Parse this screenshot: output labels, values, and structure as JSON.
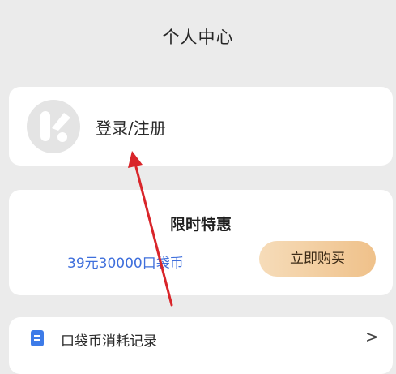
{
  "header": {
    "title": "个人中心"
  },
  "login": {
    "label": "登录/注册",
    "avatar_icon": "app-logo-k-icon"
  },
  "promo": {
    "title": "限时特惠",
    "description": "39元30000口袋币",
    "button_label": "立即购买"
  },
  "menu": {
    "items": [
      {
        "label": "口袋币消耗记录",
        "icon": "document-icon",
        "chevron": ">"
      }
    ]
  },
  "colors": {
    "background": "#ebebeb",
    "card": "#ffffff",
    "promo_text": "#3f6fdc",
    "button_gradient_start": "#f6dcb9",
    "button_gradient_end": "#efc18a",
    "menu_icon": "#3d7be8",
    "annotation_arrow": "#d9252a"
  }
}
